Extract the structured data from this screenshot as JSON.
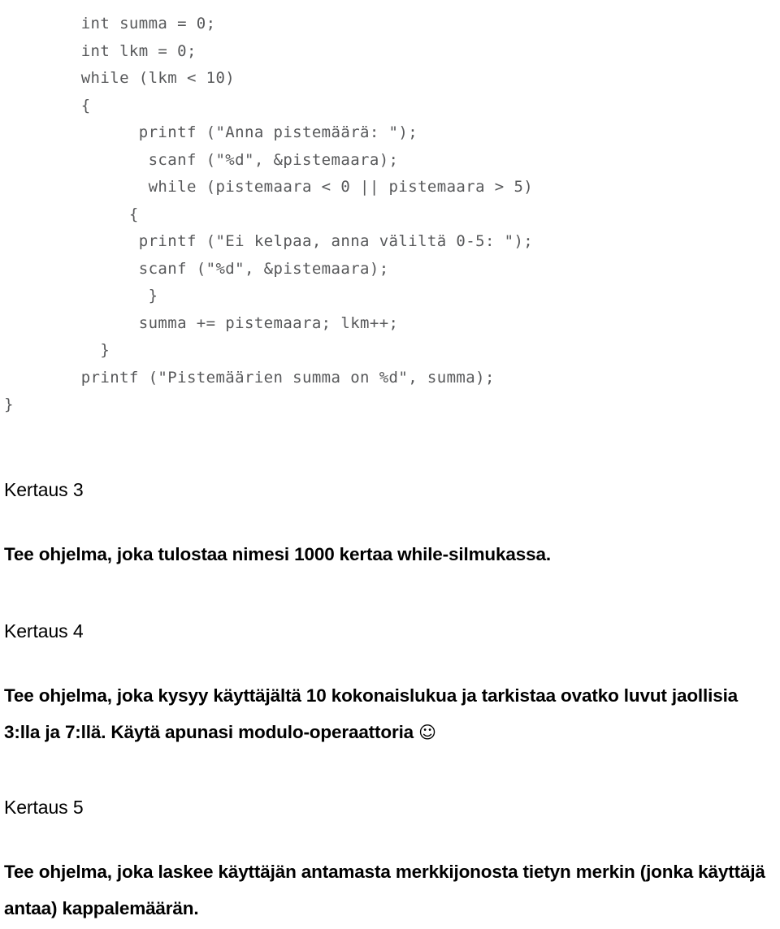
{
  "document": {
    "language": "fi",
    "code_block": {
      "language": "c",
      "lines": [
        "        int summa = 0;",
        "        int lkm = 0;",
        "        while (lkm < 10)",
        "        {",
        "              printf (\"Anna pistemäärä: \");",
        "               scanf (\"%d\", &pistemaara);",
        "               while (pistemaara < 0 || pistemaara > 5)",
        "             {",
        "              printf (\"Ei kelpaa, anna väliltä 0-5: \");",
        "              scanf (\"%d\", &pistemaara);",
        "               }",
        "              summa += pistemaara; lkm++;",
        "          }",
        "        printf (\"Pistemäärien summa on %d\", summa);",
        "}"
      ]
    },
    "sections": [
      {
        "id": "kertaus-3",
        "heading": "Kertaus 3",
        "body": "Tee ohjelma, joka tulostaa nimesi 1000 kertaa while-silmukassa."
      },
      {
        "id": "kertaus-4",
        "heading": "Kertaus 4",
        "body_line_1": "Tee ohjelma, joka kysyy käyttäjältä 10 kokonaislukua ja tarkistaa ovatko luvut jaollisia",
        "body_line_2": "3:lla ja 7:llä. Käytä apunasi modulo-operaattoria ",
        "body_smiley": "☺"
      },
      {
        "id": "kertaus-5",
        "heading": "Kertaus 5",
        "body": "Tee ohjelma, joka laskee käyttäjän antamasta merkkijonosta tietyn merkin (jonka käyttäjä antaa) kappalemäärän."
      }
    ]
  }
}
